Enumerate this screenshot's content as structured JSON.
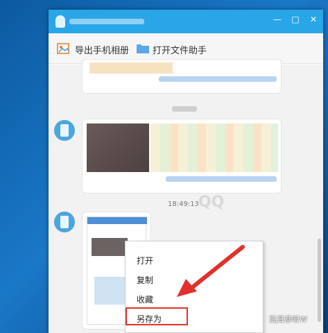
{
  "window": {
    "buttons": {
      "minimize": "—",
      "maximize": "□",
      "close": "✕"
    }
  },
  "toolbar": {
    "export_album": "导出手机相册",
    "open_assistant": "打开文件助手"
  },
  "chat": {
    "timestamp": "18:49:13",
    "watermark": "QQ"
  },
  "context_menu": {
    "items": [
      "打开",
      "复制",
      "收藏",
      "另存为"
    ]
  },
  "footer_watermark": "洗耳恭听W",
  "colors": {
    "titlebar": "#29a6e8",
    "highlight": "#e0312b",
    "arrow": "#e0312b"
  }
}
